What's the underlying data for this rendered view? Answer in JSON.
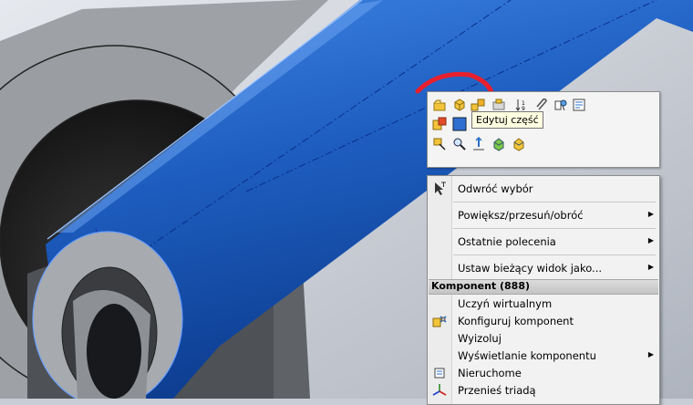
{
  "toolbar": {
    "tooltip": "Edytuj część",
    "icons": [
      "open-part-icon",
      "edit-part-icon",
      "edit-assembly-icon",
      "hide-component-icon",
      "sort-icon",
      "paperclip-icon",
      "properties-icon",
      "summary-icon",
      "component-props-icon",
      "select-component-icon",
      "zoom-to-selection-icon",
      "normal-to-icon",
      "isolate-icon",
      "show-icon"
    ]
  },
  "menu": {
    "items_top": [
      {
        "label": "Odwróć wybór",
        "icon": "select-pointer-icon"
      },
      {
        "label": "Powiększ/przesuń/obróć",
        "submenu": true
      },
      {
        "label": "Ostatnie polecenia",
        "submenu": true
      },
      {
        "label": "Ustaw bieżący widok jako...",
        "submenu": true
      }
    ],
    "section_header": "Komponent (888)",
    "items_bottom": [
      {
        "label": "Uczyń wirtualnym"
      },
      {
        "label": "Konfiguruj komponent",
        "icon": "configure-component-icon"
      },
      {
        "label": "Wyizoluj"
      },
      {
        "label": "Wyświetlanie komponentu",
        "submenu": true
      },
      {
        "label": "Nieruchome",
        "icon": "fixed-icon"
      },
      {
        "label": "Przenieś triadą",
        "icon": "triad-icon"
      }
    ]
  },
  "colors": {
    "pipe": "#1f5fbf",
    "body": "#9fa2a6",
    "annotation": "#e8202e",
    "background": "#c9ced6"
  }
}
